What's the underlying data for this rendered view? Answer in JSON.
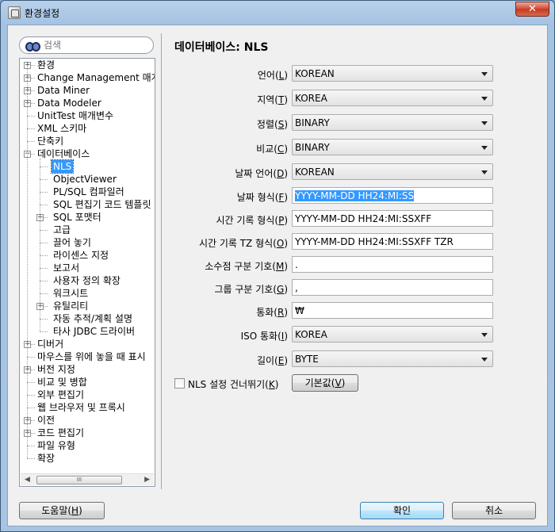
{
  "window": {
    "title": "환경설정",
    "close_label": "✕"
  },
  "search": {
    "placeholder": "검색"
  },
  "tree": [
    {
      "label": "환경",
      "level": 0,
      "expander": "+"
    },
    {
      "label": "Change Management 매개",
      "level": 0,
      "expander": "+"
    },
    {
      "label": "Data Miner",
      "level": 0,
      "expander": "+"
    },
    {
      "label": "Data Modeler",
      "level": 0,
      "expander": "+"
    },
    {
      "label": "UnitTest 매개변수",
      "level": 0,
      "expander": ""
    },
    {
      "label": "XML 스키마",
      "level": 0,
      "expander": ""
    },
    {
      "label": "단축키",
      "level": 0,
      "expander": ""
    },
    {
      "label": "데이터베이스",
      "level": 0,
      "expander": "-"
    },
    {
      "label": "NLS",
      "level": 1,
      "expander": "",
      "selected": true
    },
    {
      "label": "ObjectViewer",
      "level": 1,
      "expander": ""
    },
    {
      "label": "PL/SQL 컴파일러",
      "level": 1,
      "expander": ""
    },
    {
      "label": "SQL 편집기 코드 템플릿",
      "level": 1,
      "expander": ""
    },
    {
      "label": "SQL 포맷터",
      "level": 1,
      "expander": "+"
    },
    {
      "label": "고급",
      "level": 1,
      "expander": ""
    },
    {
      "label": "끌어 놓기",
      "level": 1,
      "expander": ""
    },
    {
      "label": "라이센스 지정",
      "level": 1,
      "expander": ""
    },
    {
      "label": "보고서",
      "level": 1,
      "expander": ""
    },
    {
      "label": "사용자 정의 확장",
      "level": 1,
      "expander": ""
    },
    {
      "label": "워크시트",
      "level": 1,
      "expander": ""
    },
    {
      "label": "유틸리티",
      "level": 1,
      "expander": "+"
    },
    {
      "label": "자동 추적/계획 설명",
      "level": 1,
      "expander": ""
    },
    {
      "label": "타사 JDBC 드라이버",
      "level": 1,
      "expander": ""
    },
    {
      "label": "디버거",
      "level": 0,
      "expander": "+"
    },
    {
      "label": "마우스를 위에 놓을 때 표시",
      "level": 0,
      "expander": ""
    },
    {
      "label": "버전 지정",
      "level": 0,
      "expander": "+"
    },
    {
      "label": "비교 및 병합",
      "level": 0,
      "expander": ""
    },
    {
      "label": "외부 편집기",
      "level": 0,
      "expander": ""
    },
    {
      "label": "웹 브라우저 및 프록시",
      "level": 0,
      "expander": ""
    },
    {
      "label": "이전",
      "level": 0,
      "expander": "+"
    },
    {
      "label": "코드 편집기",
      "level": 0,
      "expander": "+"
    },
    {
      "label": "파일 유형",
      "level": 0,
      "expander": ""
    },
    {
      "label": "확장",
      "level": 0,
      "expander": ""
    }
  ],
  "panel": {
    "title": "데이터베이스: NLS"
  },
  "fields": [
    {
      "label": "언어(",
      "key": "L",
      "type": "combo",
      "value": "KOREAN"
    },
    {
      "label": "지역(",
      "key": "T",
      "type": "combo",
      "value": "KOREA"
    },
    {
      "label": "정렬(",
      "key": "S",
      "type": "combo",
      "value": "BINARY"
    },
    {
      "label": "비교(",
      "key": "C",
      "type": "combo",
      "value": "BINARY"
    },
    {
      "label": "날짜 언어(",
      "key": "D",
      "type": "combo",
      "value": "KOREAN"
    },
    {
      "label": "날짜 형식(",
      "key": "F",
      "type": "text",
      "value": "YYYY-MM-DD HH24:MI:SS",
      "highlighted": true
    },
    {
      "label": "시간 기록 형식(",
      "key": "P",
      "type": "text",
      "value": "YYYY-MM-DD HH24:MI:SSXFF"
    },
    {
      "label": "시간 기록 TZ 형식(",
      "key": "O",
      "type": "text",
      "value": "YYYY-MM-DD HH24:MI:SSXFF TZR"
    },
    {
      "label": "소수점 구분 기호(",
      "key": "M",
      "type": "text",
      "value": "."
    },
    {
      "label": "그룹 구분 기호(",
      "key": "G",
      "type": "text",
      "value": ","
    },
    {
      "label": "통화(",
      "key": "R",
      "type": "text",
      "value": "₩"
    },
    {
      "label": "ISO 통화(",
      "key": "I",
      "type": "combo",
      "value": "KOREA"
    },
    {
      "label": "길이(",
      "key": "E",
      "type": "combo",
      "value": "BYTE"
    }
  ],
  "skip_nls": {
    "label": "NLS 설정 건너뛰기(",
    "key": "K",
    "checked": false
  },
  "buttons": {
    "defaults": {
      "label": "기본값(",
      "key": "V"
    },
    "help": {
      "label": "도움말(",
      "key": "H"
    },
    "ok": {
      "label": "확인"
    },
    "cancel": {
      "label": "취소"
    }
  },
  "scrollbar": {
    "thumb_grip": "III"
  }
}
